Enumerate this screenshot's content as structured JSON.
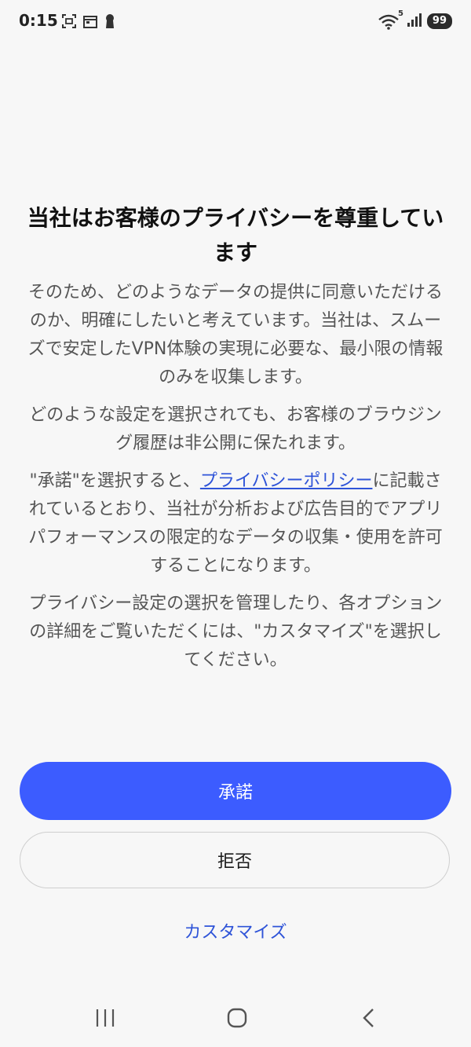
{
  "status_bar": {
    "time": "0:15",
    "network_badge": "5",
    "battery": "99",
    "icons": [
      "screenshot-icon",
      "calendar-icon",
      "keyhole-icon",
      "wifi-icon",
      "signal-icon",
      "battery-icon"
    ]
  },
  "consent": {
    "title": "当社はお客様のプライバシーを尊重しています",
    "paragraph_1": "そのため、どのようなデータの提供に同意いただけるのか、明確にしたいと考えています。当社は、スムーズで安定したVPN体験の実現に必要な、最小限の情報のみを収集します。",
    "paragraph_2": "どのような設定を選択されても、お客様のブラウジング履歴は非公開に保たれます。",
    "paragraph_3_before": "\"承諾\"を選択すると、",
    "privacy_policy_link": "プライバシーポリシー",
    "paragraph_3_after": "に記載されているとおり、当社が分析および広告目的でアプリパフォーマンスの限定的なデータの収集・使用を許可することになります。",
    "paragraph_4": "プライバシー設定の選択を管理したり、各オプションの詳細をご覧いただくには、\"カスタマイズ\"を選択してください。"
  },
  "actions": {
    "accept_label": "承諾",
    "reject_label": "拒否",
    "customize_label": "カスタマイズ"
  },
  "colors": {
    "accent": "#3c5cff",
    "link": "#2f54d8",
    "background": "#f7f7f7"
  },
  "nav_bar": {
    "icons": [
      "recent-apps-icon",
      "home-icon",
      "back-icon"
    ]
  }
}
